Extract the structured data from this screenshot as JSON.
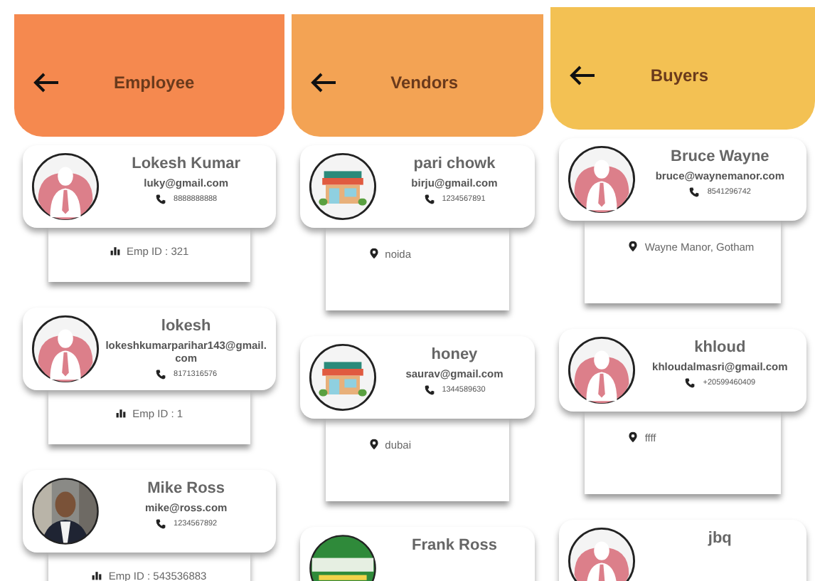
{
  "screens": [
    {
      "title": "Employee",
      "color": "#f5894f",
      "kind": "emp_id",
      "cards": [
        {
          "kind": "person",
          "name": "Lokesh Kumar",
          "email": "luky@gmail.com",
          "phone": "8888888888",
          "footer": "Emp ID : 321"
        },
        {
          "kind": "person",
          "name": "lokesh",
          "email": "lokeshkumarparihar143@gmail.com",
          "phone": "8171316576",
          "footer": "Emp ID : 1"
        },
        {
          "name": "Mike Ross",
          "email": "mike@ross.com",
          "phone": "1234567892",
          "footer": "Emp ID : 543536883"
        }
      ]
    },
    {
      "title": "Vendors",
      "color": "#f3a354",
      "kind": "location",
      "cards": [
        {
          "kind": "store",
          "name": "pari chowk",
          "email": "birju@gmail.com",
          "phone": "1234567891",
          "footer": "noida"
        },
        {
          "kind": "store",
          "name": "honey",
          "email": "saurav@gmail.com",
          "phone": "1344589630",
          "footer": "dubai"
        },
        {
          "kind": "logo",
          "name": "Frank Ross"
        }
      ]
    },
    {
      "title": "Buyers",
      "color": "#f3c153",
      "kind": "location",
      "cards": [
        {
          "kind": "person",
          "name": "Bruce Wayne",
          "email": "bruce@waynemanor.com",
          "phone": "8541296742",
          "footer": "Wayne Manor, Gotham"
        },
        {
          "kind": "person",
          "name": "khloud",
          "email": "khloudalmasri@gmail.com",
          "phone": "+20599460409",
          "footer": "ffff"
        },
        {
          "kind": "person",
          "name": "jbq"
        }
      ]
    }
  ]
}
